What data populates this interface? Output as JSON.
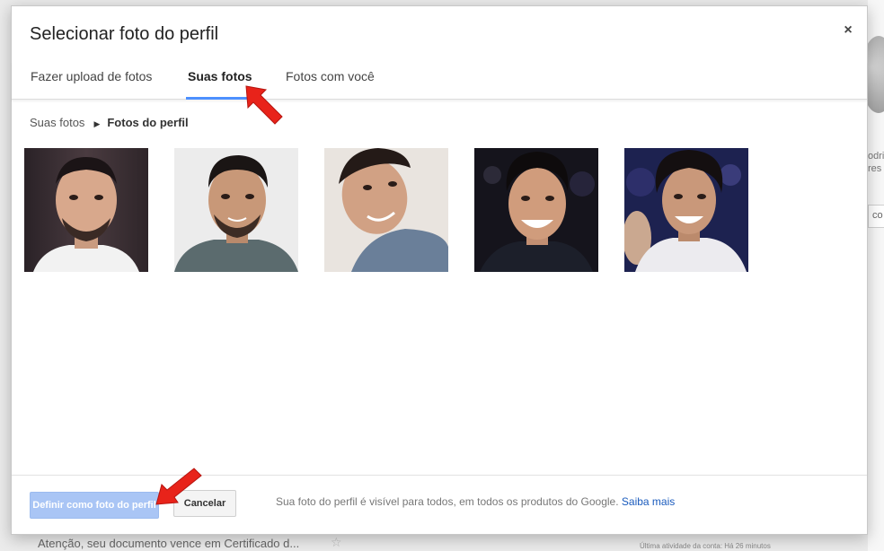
{
  "dialog": {
    "title": "Selecionar foto do perfil",
    "close_glyph": "×"
  },
  "tabs": [
    {
      "label": "Fazer upload de fotos",
      "active": false
    },
    {
      "label": "Suas fotos",
      "active": true
    },
    {
      "label": "Fotos com você",
      "active": false
    }
  ],
  "breadcrumb": {
    "root": "Suas fotos",
    "separator_icon": "caret-right-icon",
    "current": "Fotos do perfil"
  },
  "photos": [
    {
      "label": "profile-photo-1"
    },
    {
      "label": "profile-photo-2"
    },
    {
      "label": "profile-photo-3"
    },
    {
      "label": "profile-photo-4"
    },
    {
      "label": "profile-photo-5"
    }
  ],
  "footer": {
    "primary_label": "Definir como foto do perfil",
    "secondary_label": "Cancelar",
    "note": "Sua foto do perfil é visível para todos, em todos os produtos do Google.",
    "learn_more": "Saiba mais"
  },
  "background": {
    "bottom_text": "Atenção, seu documento vence em Certificado d...",
    "activity_text": "Última atividade da conta: Há 26 minutos",
    "right_snippet_1": "odri",
    "right_snippet_2": "res",
    "right_snippet_3": "co"
  },
  "colors": {
    "accent": "#4d90fe",
    "primary_button": "#a9c5f5",
    "link": "#1a5bbd",
    "arrow": "#e8231a"
  }
}
